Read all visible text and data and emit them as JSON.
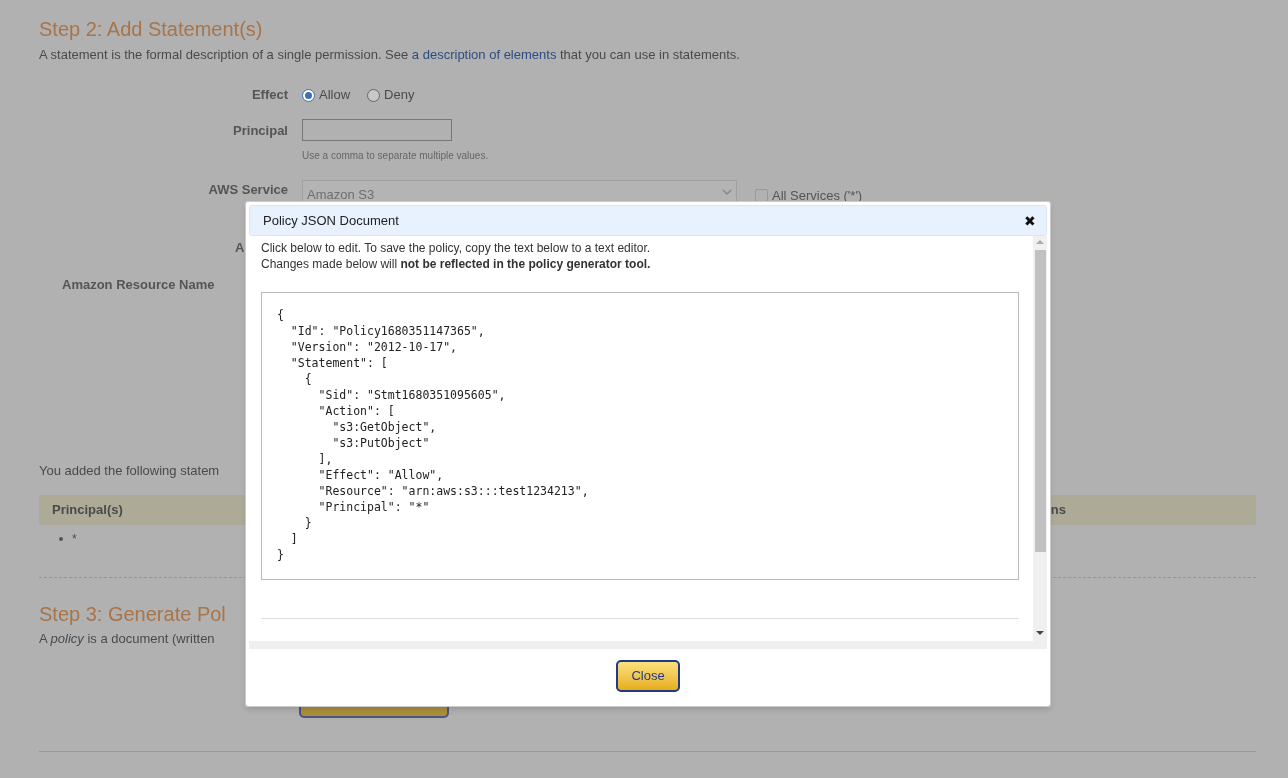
{
  "step2": {
    "title": "Step 2: Add Statement(s)",
    "description_before": "A statement is the formal description of a single permission. See ",
    "description_link": "a description of elements",
    "description_after": " that you can use in statements.",
    "effect": {
      "label": "Effect",
      "options": [
        {
          "label": "Allow",
          "selected": true
        },
        {
          "label": "Deny",
          "selected": false
        }
      ]
    },
    "principal": {
      "label": "Principal",
      "hint": "Use a comma to separate multiple values."
    },
    "aws_service": {
      "label": "AWS Service",
      "value": "Amazon S3",
      "disabled": true,
      "all_services": {
        "label": "All Services ('*')",
        "checked": false
      }
    },
    "actions_label": "A",
    "arn_label": "Amazon Resource Name"
  },
  "statements": {
    "intro": "You added the following statem",
    "columns": [
      "Principal(s)",
      "ns"
    ],
    "principals": [
      "*"
    ]
  },
  "step3": {
    "title": "Step 3: Generate Pol",
    "description": "A *policy* is a document (written"
  },
  "modal": {
    "title": "Policy JSON Document",
    "close_icon": "✖",
    "note_line1": "Click below to edit. To save the policy, copy the text below to a text editor.",
    "note_line2": "Changes made below will **not be reflected in the policy generator tool.**",
    "document": "{\n  \"Id\": \"Policy1680351147365\",\n  \"Version\": \"2012-10-17\",\n  \"Statement\": [\n    {\n      \"Sid\": \"Stmt1680351095605\",\n      \"Action\": [\n        \"s3:GetObject\",\n        \"s3:PutObject\"\n      ],\n      \"Effect\": \"Allow\",\n      \"Resource\": \"arn:aws:s3:::test1234213\",\n      \"Principal\": \"*\"\n    }\n  ]\n}",
    "button": "Close"
  }
}
